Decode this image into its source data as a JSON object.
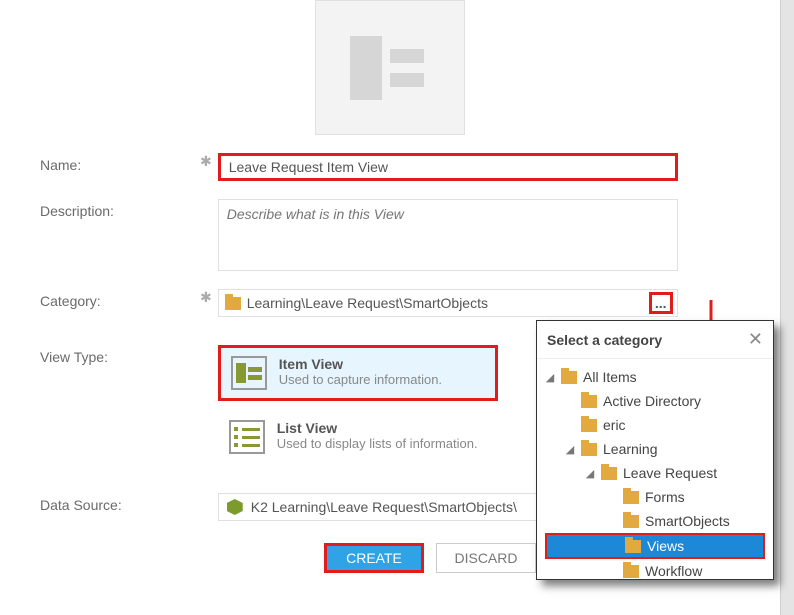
{
  "fields": {
    "name_label": "Name:",
    "name_value": "Leave Request Item View",
    "description_label": "Description:",
    "description_placeholder": "Describe what is in this View",
    "category_label": "Category:",
    "category_value": "Learning\\Leave Request\\SmartObjects",
    "view_type_label": "View Type:",
    "data_source_label": "Data Source:",
    "data_source_value": "K2 Learning\\Leave Request\\SmartObjects\\"
  },
  "view_types": {
    "item": {
      "title": "Item View",
      "desc": "Used to capture information."
    },
    "list": {
      "title": "List View",
      "desc": "Used to display lists of information."
    }
  },
  "popup": {
    "title": "Select a category",
    "tree": {
      "root": "All Items",
      "n0": "Active Directory",
      "n1": "eric",
      "n2": "Learning",
      "n3": "Leave Request",
      "n4": "Forms",
      "n5": "SmartObjects",
      "n6": "Views",
      "n7": "Workflow"
    }
  },
  "buttons": {
    "create": "CREATE",
    "discard": "DISCARD",
    "ellipsis": "..."
  }
}
